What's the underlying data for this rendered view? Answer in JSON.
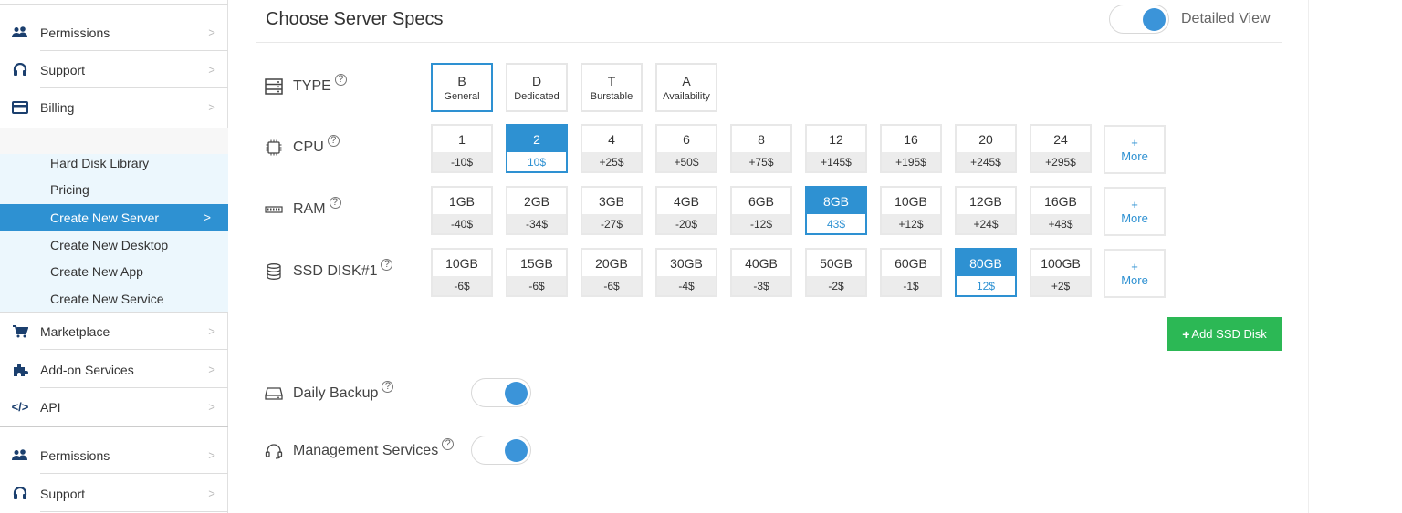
{
  "sidebar": {
    "top_items": [
      {
        "label": "Permissions",
        "icon": "users-icon"
      },
      {
        "label": "Support",
        "icon": "headset-icon"
      },
      {
        "label": "Billing",
        "icon": "credit-card-icon"
      }
    ],
    "sub_items": [
      {
        "label": "Hard Disk Library"
      },
      {
        "label": "Pricing"
      },
      {
        "label": "Create New Server",
        "active": true
      },
      {
        "label": "Create New Desktop"
      },
      {
        "label": "Create New App"
      },
      {
        "label": "Create New Service"
      }
    ],
    "mid_items": [
      {
        "label": "Marketplace",
        "icon": "cart-icon"
      },
      {
        "label": "Add-on Services",
        "icon": "puzzle-icon"
      },
      {
        "label": "API",
        "icon": "code-icon"
      }
    ],
    "bottom_items": [
      {
        "label": "Permissions",
        "icon": "users-icon"
      },
      {
        "label": "Support",
        "icon": "headset-icon"
      }
    ]
  },
  "main": {
    "title": "Choose Server Specs",
    "detailed_view_label": "Detailed View",
    "type": {
      "label": "TYPE",
      "options": [
        {
          "letter": "B",
          "name": "General",
          "selected": true
        },
        {
          "letter": "D",
          "name": "Dedicated"
        },
        {
          "letter": "T",
          "name": "Burstable"
        },
        {
          "letter": "A",
          "name": "Availability"
        }
      ]
    },
    "cpu": {
      "label": "CPU",
      "options": [
        {
          "value": "1",
          "price": "-10$"
        },
        {
          "value": "2",
          "price": "10$",
          "selected": true
        },
        {
          "value": "4",
          "price": "+25$"
        },
        {
          "value": "6",
          "price": "+50$"
        },
        {
          "value": "8",
          "price": "+75$"
        },
        {
          "value": "12",
          "price": "+145$"
        },
        {
          "value": "16",
          "price": "+195$"
        },
        {
          "value": "20",
          "price": "+245$"
        },
        {
          "value": "24",
          "price": "+295$"
        }
      ]
    },
    "ram": {
      "label": "RAM",
      "options": [
        {
          "value": "1GB",
          "price": "-40$"
        },
        {
          "value": "2GB",
          "price": "-34$"
        },
        {
          "value": "3GB",
          "price": "-27$"
        },
        {
          "value": "4GB",
          "price": "-20$"
        },
        {
          "value": "6GB",
          "price": "-12$"
        },
        {
          "value": "8GB",
          "price": "43$",
          "selected": true
        },
        {
          "value": "10GB",
          "price": "+12$"
        },
        {
          "value": "12GB",
          "price": "+24$"
        },
        {
          "value": "16GB",
          "price": "+48$"
        }
      ]
    },
    "ssd": {
      "label": "SSD DISK#1",
      "options": [
        {
          "value": "10GB",
          "price": "-6$"
        },
        {
          "value": "15GB",
          "price": "-6$"
        },
        {
          "value": "20GB",
          "price": "-6$"
        },
        {
          "value": "30GB",
          "price": "-4$"
        },
        {
          "value": "40GB",
          "price": "-3$"
        },
        {
          "value": "50GB",
          "price": "-2$"
        },
        {
          "value": "60GB",
          "price": "-1$"
        },
        {
          "value": "80GB",
          "price": "12$",
          "selected": true
        },
        {
          "value": "100GB",
          "price": "+2$"
        }
      ]
    },
    "more": {
      "plus": "+",
      "label": "More"
    },
    "add_ssd_label": "Add SSD Disk",
    "daily_backup_label": "Daily Backup",
    "management_label": "Management Services",
    "help_glyph": "?"
  },
  "colors": {
    "accent": "#2e91d2",
    "green": "#2cb855",
    "toggle_knob": "#3b94d9"
  }
}
